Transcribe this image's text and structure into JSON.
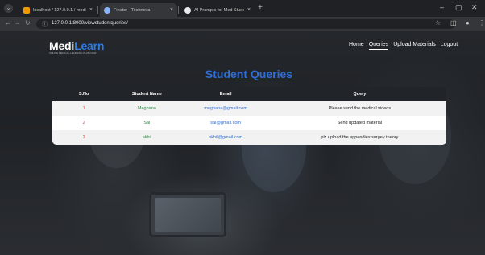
{
  "browser": {
    "tabs": [
      {
        "label": "localhost / 127.0.0.1 / medical",
        "color": "#f29900"
      },
      {
        "label": "Fineter - Technova",
        "color": "#8ab4f8"
      },
      {
        "label": "AI Prompts for Med Students",
        "color": "#e8eaed"
      }
    ],
    "new_tab_label": "+",
    "url": "127.0.0.1:8000/viewstudentqueries/",
    "win_min": "–",
    "win_max": "▢",
    "win_close": "✕"
  },
  "site": {
    "logo_part1": "Medi",
    "logo_part2": "Learn",
    "logo_tagline": "ONLINE MEDICAL LEARNING PLATFORM",
    "nav": [
      "Home",
      "Queries",
      "Upload Materials",
      "Logout"
    ],
    "active_nav": "Queries"
  },
  "main": {
    "title": "Student Queries",
    "columns": [
      "S.No",
      "Student Name",
      "Email",
      "Query"
    ],
    "rows": [
      {
        "sno": "1",
        "name": "Meghana",
        "email": "meghana@gmail.com",
        "query": "Please send the medical videos"
      },
      {
        "sno": "2",
        "name": "Sai",
        "email": "sai@gmail.com",
        "query": "Send updated material"
      },
      {
        "sno": "3",
        "name": "akhil",
        "email": "akhil@gmail.com",
        "query": "plz upload the appendies surgey theory"
      }
    ]
  },
  "colors": {
    "accent": "#2f6fd6",
    "sno": "#e0424b",
    "name": "#2f8a45",
    "header_bg": "#212529"
  }
}
